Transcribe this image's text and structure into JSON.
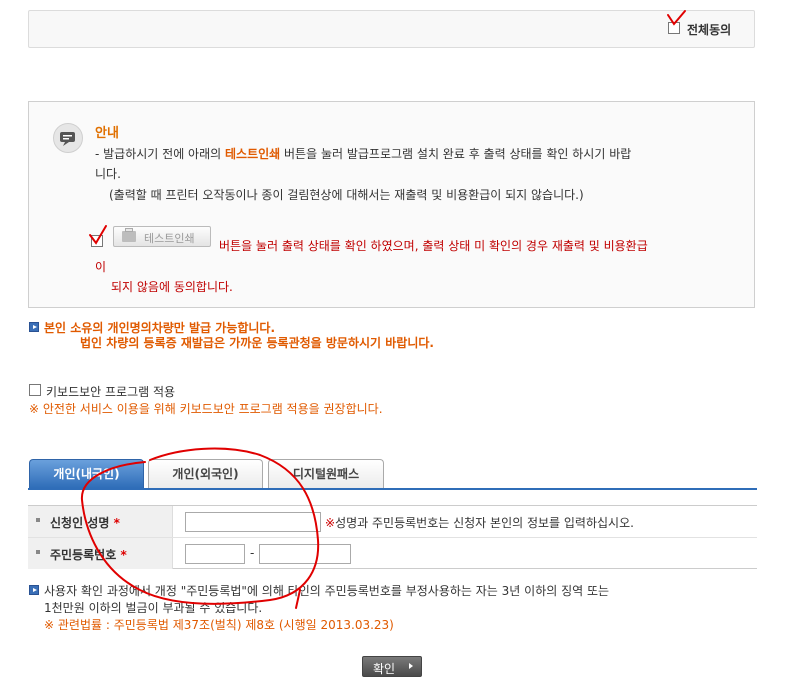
{
  "agree_all": {
    "label": "전체동의",
    "checked": false
  },
  "notice": {
    "title": "안내",
    "line1_pre": "- 발급하시기 전에 아래의 ",
    "line1_highlight": "테스트인쇄",
    "line1_post": " 버튼을 눌러 발급프로그램 설치 완료 후 출력 상태를 확인 하시기 바랍",
    "line1_wrap": "니다.",
    "line2": "(출력할 때 프린터 오작동이나 종이 걸림현상에 대해서는 재출력 및 비용환급이 되지 않습니다.)",
    "test_print_label": "테스트인쇄",
    "consent_line1": "버튼을 눌러 출력 상태를 확인 하였으며, 출력 상태 미 확인의 경우 재출력 및 비용환급",
    "consent_line2": "이",
    "consent_line3": "되지 않음에 동의합니다."
  },
  "owner_notice": {
    "line1": "본인 소유의 개인명의차량만 발급 가능합니다.",
    "line2": "법인 차량의 등록증 재발급은 가까운 등록관청을 방문하시기 바랍니다."
  },
  "keyboard": {
    "label": "키보드보안 프로그램 적용",
    "note": "※ 안전한 서비스 이용을 위해 키보드보안 프로그램 적용을 권장합니다."
  },
  "tabs": [
    {
      "label": "개인(내국인)",
      "active": true
    },
    {
      "label": "개인(외국인)",
      "active": false
    },
    {
      "label": "디지털원패스",
      "active": false
    }
  ],
  "form": {
    "name_label": "신청인 성명",
    "rrn_label": "주민등록번호",
    "required_mark": "*",
    "name_hint_mark": "※",
    "name_hint": "성명과 주민등록번호는 신청자 본인의 정보를 입력하십시오.",
    "rrn_separator": "-",
    "name_value": "",
    "rrn_front_value": "",
    "rrn_back_value": ""
  },
  "legal": {
    "line1": "사용자 확인 과정에서 개정 \"주민등록법\"에 의해 타인의 주민등록번호를 부정사용하는 자는 3년 이하의 징역 또는",
    "line2": "1천만원 이하의 벌금이 부과될 수 있습니다.",
    "line3": "※ 관련법률 : 주민등록법 제37조(벌칙) 제8호 (시행일 2013.03.23)"
  },
  "confirm_label": "확인",
  "colors": {
    "accent": "#2f6db8",
    "highlight": "#e05a00",
    "warning": "#c00000",
    "annotation": "#e00000"
  }
}
